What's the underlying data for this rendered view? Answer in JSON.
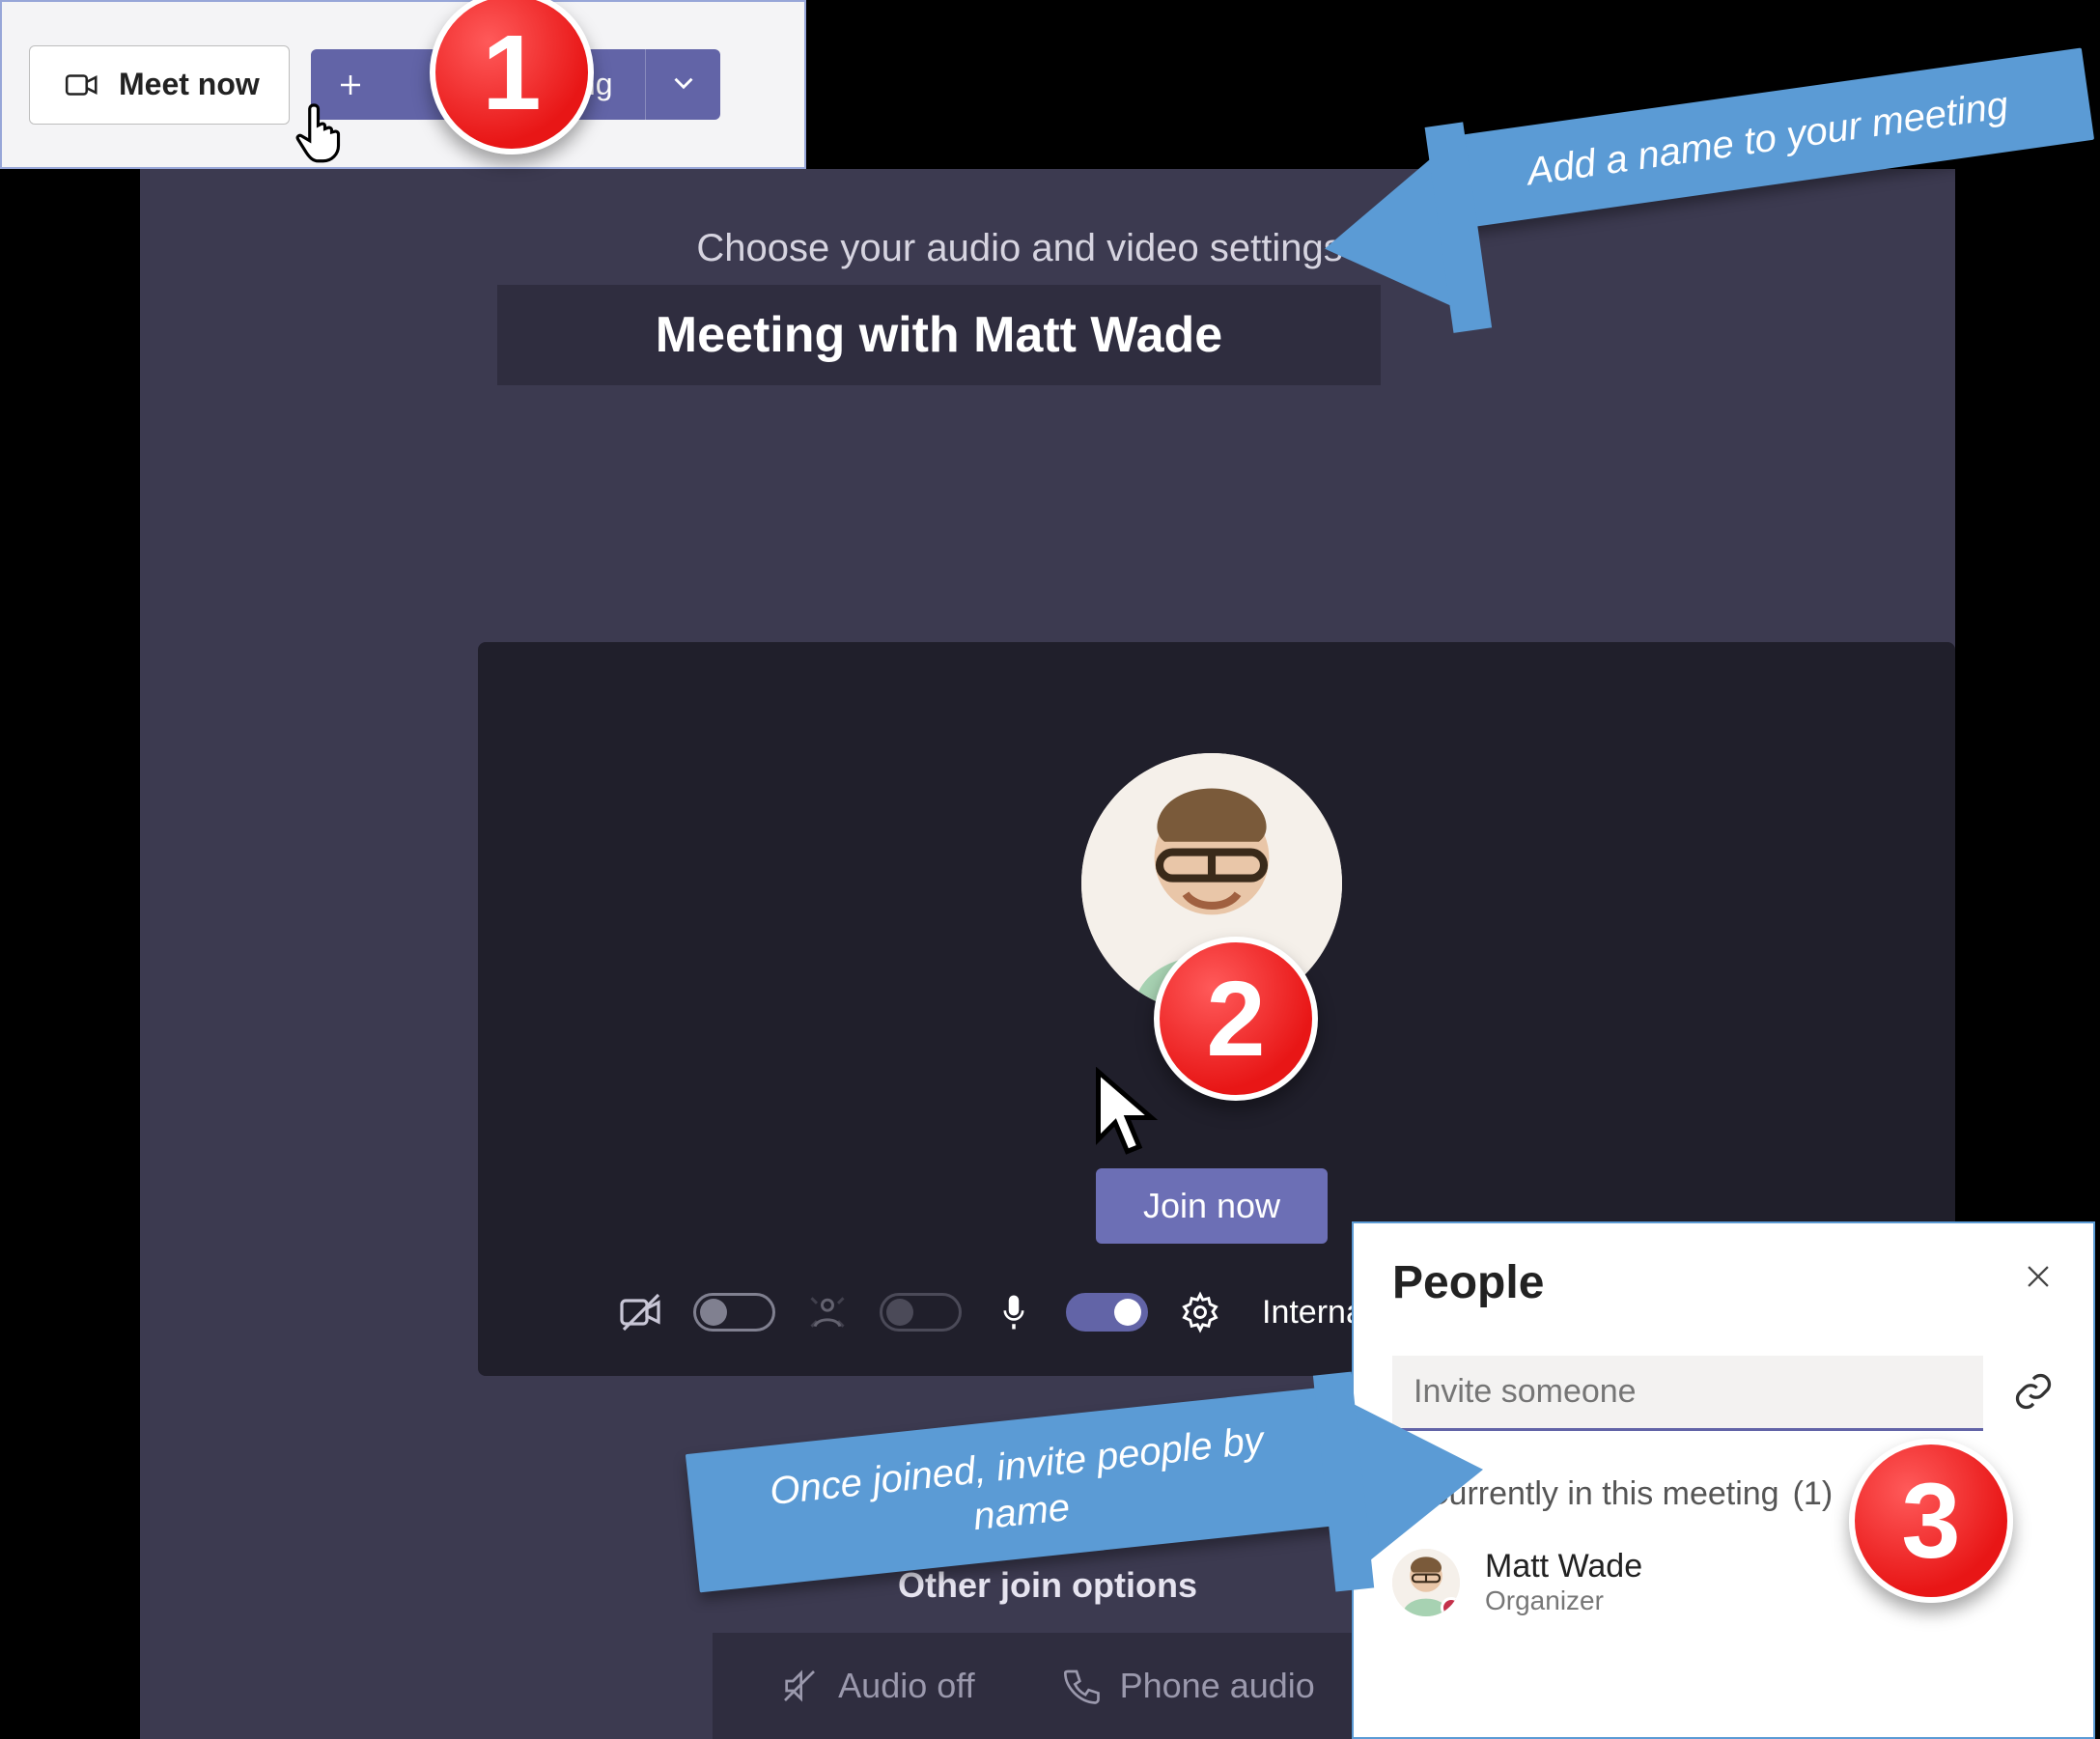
{
  "toolbar": {
    "meet_now": "Meet now",
    "new_meeting_suffix": "ing"
  },
  "callouts": {
    "step1": "1",
    "step2": "2",
    "step3": "3",
    "add_name": "Add a name to your meeting",
    "invite_people": "Once joined, invite people by name"
  },
  "settings": {
    "heading": "Choose your audio and video settings for",
    "meeting_name": "Meeting with Matt Wade",
    "join_now": "Join now",
    "device_label": "Internal Mic and Speakers"
  },
  "other": {
    "title": "Other join options",
    "audio_off": "Audio off",
    "phone_audio": "Phone audio"
  },
  "people": {
    "title": "People",
    "invite_placeholder": "Invite someone",
    "currently": "Currently in this meeting",
    "count": "(1)",
    "attendee_name": "Matt Wade",
    "attendee_role": "Organizer"
  }
}
